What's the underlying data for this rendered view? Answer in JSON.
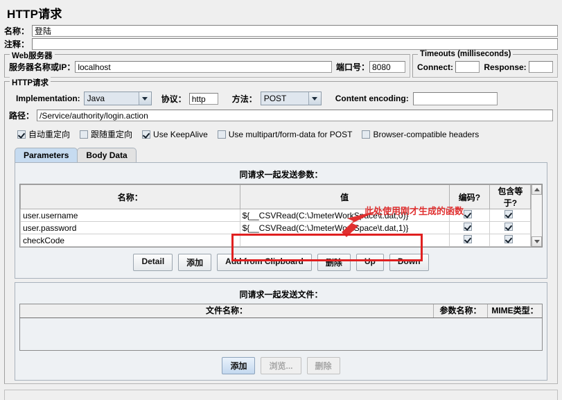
{
  "header": {
    "title": "HTTP请求"
  },
  "name_row": {
    "label": "名称：",
    "value": "登陆"
  },
  "comment_row": {
    "label": "注释：",
    "value": ""
  },
  "web_server": {
    "title": "Web服务器",
    "server_label": "服务器名称或IP：",
    "server_value": "localhost",
    "port_label": "端口号：",
    "port_value": "8080"
  },
  "timeouts": {
    "title": "Timeouts (milliseconds)",
    "connect_label": "Connect:",
    "connect_value": "",
    "response_label": "Response:",
    "response_value": ""
  },
  "http_request": {
    "title": "HTTP请求",
    "implementation_label": "Implementation:",
    "implementation_value": "Java",
    "protocol_label": "协议：",
    "protocol_value": "http",
    "method_label": "方法：",
    "method_value": "POST",
    "content_encoding_label": "Content encoding:",
    "content_encoding_value": "",
    "path_label": "路径：",
    "path_value": "/Service/authority/login.action",
    "checkboxes": [
      {
        "label": "自动重定向",
        "checked": true
      },
      {
        "label": "跟随重定向",
        "checked": false
      },
      {
        "label": "Use KeepAlive",
        "checked": true
      },
      {
        "label": "Use multipart/form-data for POST",
        "checked": false
      },
      {
        "label": "Browser-compatible headers",
        "checked": false
      }
    ]
  },
  "tabs": [
    {
      "label": "Parameters",
      "active": true
    },
    {
      "label": "Body Data",
      "active": false
    }
  ],
  "parameters": {
    "caption": "同请求一起发送参数：",
    "columns": [
      "名称：",
      "值",
      "编码?",
      "包含等于?"
    ],
    "rows": [
      {
        "name": "user.username",
        "value": "${__CSVRead(C:\\JmeterWorkSpace\\t.dat,0)}",
        "encode": true,
        "include_equals": true
      },
      {
        "name": "user.password",
        "value": "${__CSVRead(C:\\JmeterWorkSpace\\t.dat,1)}",
        "encode": true,
        "include_equals": true
      },
      {
        "name": "checkCode",
        "value": "",
        "encode": true,
        "include_equals": true
      }
    ],
    "buttons": [
      {
        "label": "Detail",
        "state": "normal"
      },
      {
        "label": "添加",
        "state": "normal"
      },
      {
        "label": "Add from Clipboard",
        "state": "normal"
      },
      {
        "label": "删除",
        "state": "normal"
      },
      {
        "label": "Up",
        "state": "normal"
      },
      {
        "label": "Down",
        "state": "normal"
      }
    ]
  },
  "files": {
    "caption": "同请求一起发送文件：",
    "columns": [
      "文件名称：",
      "参数名称：",
      "MIME类型："
    ],
    "buttons": [
      {
        "label": "添加",
        "state": "primary"
      },
      {
        "label": "浏览...",
        "state": "disabled"
      },
      {
        "label": "删除",
        "state": "disabled"
      }
    ]
  },
  "annotation": {
    "text": "此处使用刚才生成的函数",
    "color": "#e03030"
  }
}
